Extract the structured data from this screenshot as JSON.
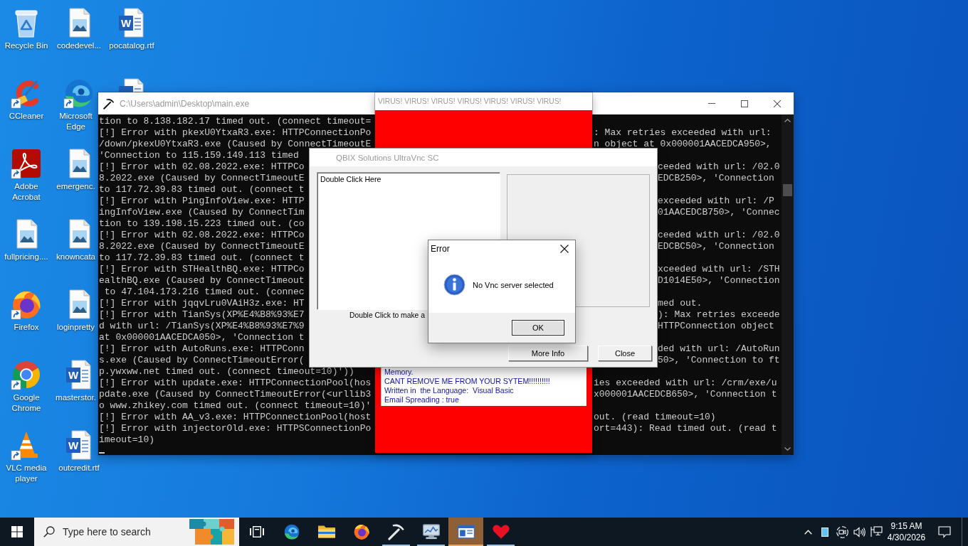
{
  "desktop": {
    "icons": [
      {
        "label": "Recycle Bin",
        "kind": "recycle-bin",
        "shortcut": false
      },
      {
        "label": "CCleaner",
        "kind": "ccleaner",
        "shortcut": true
      },
      {
        "label": "Adobe Acrobat",
        "kind": "acrobat",
        "shortcut": true
      },
      {
        "label": "fullpricing....",
        "kind": "image-file",
        "shortcut": false
      },
      {
        "label": "Firefox",
        "kind": "firefox",
        "shortcut": true
      },
      {
        "label": "Google Chrome",
        "kind": "chrome",
        "shortcut": true
      },
      {
        "label": "VLC media player",
        "kind": "vlc",
        "shortcut": true
      },
      {
        "label": "codedevel...",
        "kind": "image-file",
        "shortcut": false
      },
      {
        "label": "Microsoft Edge",
        "kind": "edge",
        "shortcut": true
      },
      {
        "label": "emergenc.",
        "kind": "image-file",
        "shortcut": false
      },
      {
        "label": "knowncata",
        "kind": "image-file",
        "shortcut": false
      },
      {
        "label": "loginpretty",
        "kind": "image-file",
        "shortcut": false
      },
      {
        "label": "masterstor.",
        "kind": "word-doc",
        "badge": "W",
        "shortcut": false
      },
      {
        "label": "outcredit.rtf",
        "kind": "word-doc",
        "badge": "W",
        "shortcut": false
      },
      {
        "label": "pocatalog.rtf",
        "kind": "word-doc",
        "badge": "W",
        "shortcut": false
      },
      {
        "kind": "word-doc"
      }
    ]
  },
  "console_window": {
    "title": "C:\\Users\\admin\\Desktop\\main.exe",
    "active": false,
    "lines": [
      {
        "left": "tion to 8.138.182.17 timed out. (connect timeout="
      },
      {
        "left": "[!] Error with pkexU0YtxaR3.exe: HTTPConnectionPo",
        "right": ": Max retries exceeded with url:"
      },
      {
        "left": "/down/pkexU0YtxaR3.exe (Caused by ConnectTimeoutE",
        "right": "n object at 0x000001AACEDCA950>,"
      },
      {
        "left": "'Connection to 115.159.149.113 timed"
      },
      {
        "left": "[!] Error with 02.08.2022.exe: HTTPCo",
        "right": "ceeded with url: /02.0"
      },
      {
        "left": "8.2022.exe (Caused by ConnectTimeoutE",
        "right": "EDCB250>, 'Connection"
      },
      {
        "left": "to 117.72.39.83 timed out. (connect t"
      },
      {
        "left": "[!] Error with PingInfoView.exe: HTTP",
        "right": "exceeded with url: /P"
      },
      {
        "left": "ingInfoView.exe (Caused by ConnectTim",
        "right": "01AACEDCB750>, 'Connec"
      },
      {
        "left": "tion to 139.198.15.223 timed out. (co"
      },
      {
        "left": "[!] Error with 02.08.2022.exe: HTTPCo",
        "right": "ceeded with url: /02.0"
      },
      {
        "left": "8.2022.exe (Caused by ConnectTimeoutE",
        "right": "EDCBC50>, 'Connection"
      },
      {
        "left": "to 117.72.39.83 timed out. (connect t"
      },
      {
        "left": "[!] Error with STHealthBQ.exe: HTTPCo",
        "right": "xceeded with url: /STH"
      },
      {
        "left": "ealthBQ.exe (Caused by ConnectTimeout",
        "right": "D1014E50>, 'Connection"
      },
      {
        "left": " to 47.104.173.216 timed out. (connec"
      },
      {
        "left": "[!] Error with jqqvLru0VAiH3z.exe: HT",
        "right": "med out."
      },
      {
        "left": "[!] Error with TianSys(XP%E4%B8%93%E7",
        "right": "): Max retries exceede"
      },
      {
        "left": "d with url: /TianSys(XP%E4%B8%93%E7%9",
        "right": "HTTPConnection object"
      },
      {
        "left": "at 0x000001AACEDCA050>, 'Connection t"
      },
      {
        "left": "[!] Error with AutoRuns.exe: HTTPConn",
        "right": "ded with url: /AutoRun"
      },
      {
        "left": "s.exe (Caused by ConnectTimeoutError(",
        "right": "50>, 'Connection to ft"
      },
      {
        "left": "p.ywxww.net timed out. (connect timeout=10)'))"
      },
      {
        "left": "[!] Error with update.exe: HTTPConnectionPool(hos",
        "right": "ies exceeded with url: /crm/exe/u"
      },
      {
        "left": "pdate.exe (Caused by ConnectTimeoutError(<urllib3",
        "right": "x000001AACEDCB650>, 'Connection t"
      },
      {
        "left": "o www.zhikey.com timed out. (connect timeout=10)'"
      },
      {
        "left": "[!] Error with AA_v3.exe: HTTPConnectionPool(host",
        "right": "out. (read timeout=10)"
      },
      {
        "left": "[!] Error with injectorOld.exe: HTTPSConnectionPo",
        "right": "ort=443): Read timed out. (read t"
      },
      {
        "left": "imeout=10)"
      }
    ]
  },
  "virus_window": {
    "title": "VIRUS! VIRUS! VIRUS! VIRUS! VIRUS! VIRUS! VIRUS!",
    "active": false,
    "messages": [
      "Memory.",
      "CANT REMOVE ME FROM YOUR SYTEM!!!!!!!!!!",
      "Written in  the Language:  Visual Basic",
      "Email Spreading : true"
    ]
  },
  "vnc_dialog": {
    "title": "QBIX Solutions UltraVnc SC",
    "active": false,
    "list_items": [
      "Double Click Here"
    ],
    "hint": "Double Click to make a",
    "buttons": [
      "More Info",
      "Close"
    ]
  },
  "error_dialog": {
    "title": "Error",
    "active": true,
    "message": "No Vnc server selected",
    "buttons": [
      "OK"
    ]
  },
  "taskbar": {
    "search": {
      "placeholder": "Type here to search"
    },
    "apps": [
      {
        "kind": "edge",
        "running": false,
        "selected": false
      },
      {
        "kind": "folder",
        "running": false,
        "selected": false
      },
      {
        "kind": "firefox",
        "running": false,
        "selected": false
      },
      {
        "kind": "pickaxe",
        "running": true,
        "selected": false
      },
      {
        "kind": "monitor",
        "running": true,
        "selected": false
      },
      {
        "kind": "window",
        "running": true,
        "selected": true
      },
      {
        "kind": "heart",
        "running": true,
        "selected": false
      }
    ],
    "clock": {
      "time": "9:15 AM",
      "date": "4/30/2026"
    }
  }
}
